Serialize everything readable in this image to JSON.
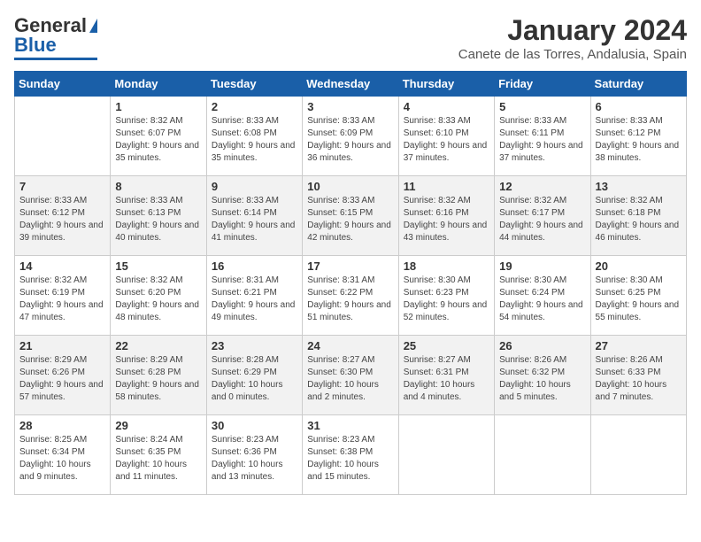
{
  "header": {
    "logo_general": "General",
    "logo_blue": "Blue",
    "title": "January 2024",
    "subtitle": "Canete de las Torres, Andalusia, Spain"
  },
  "days_of_week": [
    "Sunday",
    "Monday",
    "Tuesday",
    "Wednesday",
    "Thursday",
    "Friday",
    "Saturday"
  ],
  "weeks": [
    [
      {
        "day": "",
        "sunrise": "",
        "sunset": "",
        "daylight": ""
      },
      {
        "day": "1",
        "sunrise": "Sunrise: 8:32 AM",
        "sunset": "Sunset: 6:07 PM",
        "daylight": "Daylight: 9 hours and 35 minutes."
      },
      {
        "day": "2",
        "sunrise": "Sunrise: 8:33 AM",
        "sunset": "Sunset: 6:08 PM",
        "daylight": "Daylight: 9 hours and 35 minutes."
      },
      {
        "day": "3",
        "sunrise": "Sunrise: 8:33 AM",
        "sunset": "Sunset: 6:09 PM",
        "daylight": "Daylight: 9 hours and 36 minutes."
      },
      {
        "day": "4",
        "sunrise": "Sunrise: 8:33 AM",
        "sunset": "Sunset: 6:10 PM",
        "daylight": "Daylight: 9 hours and 37 minutes."
      },
      {
        "day": "5",
        "sunrise": "Sunrise: 8:33 AM",
        "sunset": "Sunset: 6:11 PM",
        "daylight": "Daylight: 9 hours and 37 minutes."
      },
      {
        "day": "6",
        "sunrise": "Sunrise: 8:33 AM",
        "sunset": "Sunset: 6:12 PM",
        "daylight": "Daylight: 9 hours and 38 minutes."
      }
    ],
    [
      {
        "day": "7",
        "sunrise": "Sunrise: 8:33 AM",
        "sunset": "Sunset: 6:12 PM",
        "daylight": "Daylight: 9 hours and 39 minutes."
      },
      {
        "day": "8",
        "sunrise": "Sunrise: 8:33 AM",
        "sunset": "Sunset: 6:13 PM",
        "daylight": "Daylight: 9 hours and 40 minutes."
      },
      {
        "day": "9",
        "sunrise": "Sunrise: 8:33 AM",
        "sunset": "Sunset: 6:14 PM",
        "daylight": "Daylight: 9 hours and 41 minutes."
      },
      {
        "day": "10",
        "sunrise": "Sunrise: 8:33 AM",
        "sunset": "Sunset: 6:15 PM",
        "daylight": "Daylight: 9 hours and 42 minutes."
      },
      {
        "day": "11",
        "sunrise": "Sunrise: 8:32 AM",
        "sunset": "Sunset: 6:16 PM",
        "daylight": "Daylight: 9 hours and 43 minutes."
      },
      {
        "day": "12",
        "sunrise": "Sunrise: 8:32 AM",
        "sunset": "Sunset: 6:17 PM",
        "daylight": "Daylight: 9 hours and 44 minutes."
      },
      {
        "day": "13",
        "sunrise": "Sunrise: 8:32 AM",
        "sunset": "Sunset: 6:18 PM",
        "daylight": "Daylight: 9 hours and 46 minutes."
      }
    ],
    [
      {
        "day": "14",
        "sunrise": "Sunrise: 8:32 AM",
        "sunset": "Sunset: 6:19 PM",
        "daylight": "Daylight: 9 hours and 47 minutes."
      },
      {
        "day": "15",
        "sunrise": "Sunrise: 8:32 AM",
        "sunset": "Sunset: 6:20 PM",
        "daylight": "Daylight: 9 hours and 48 minutes."
      },
      {
        "day": "16",
        "sunrise": "Sunrise: 8:31 AM",
        "sunset": "Sunset: 6:21 PM",
        "daylight": "Daylight: 9 hours and 49 minutes."
      },
      {
        "day": "17",
        "sunrise": "Sunrise: 8:31 AM",
        "sunset": "Sunset: 6:22 PM",
        "daylight": "Daylight: 9 hours and 51 minutes."
      },
      {
        "day": "18",
        "sunrise": "Sunrise: 8:30 AM",
        "sunset": "Sunset: 6:23 PM",
        "daylight": "Daylight: 9 hours and 52 minutes."
      },
      {
        "day": "19",
        "sunrise": "Sunrise: 8:30 AM",
        "sunset": "Sunset: 6:24 PM",
        "daylight": "Daylight: 9 hours and 54 minutes."
      },
      {
        "day": "20",
        "sunrise": "Sunrise: 8:30 AM",
        "sunset": "Sunset: 6:25 PM",
        "daylight": "Daylight: 9 hours and 55 minutes."
      }
    ],
    [
      {
        "day": "21",
        "sunrise": "Sunrise: 8:29 AM",
        "sunset": "Sunset: 6:26 PM",
        "daylight": "Daylight: 9 hours and 57 minutes."
      },
      {
        "day": "22",
        "sunrise": "Sunrise: 8:29 AM",
        "sunset": "Sunset: 6:28 PM",
        "daylight": "Daylight: 9 hours and 58 minutes."
      },
      {
        "day": "23",
        "sunrise": "Sunrise: 8:28 AM",
        "sunset": "Sunset: 6:29 PM",
        "daylight": "Daylight: 10 hours and 0 minutes."
      },
      {
        "day": "24",
        "sunrise": "Sunrise: 8:27 AM",
        "sunset": "Sunset: 6:30 PM",
        "daylight": "Daylight: 10 hours and 2 minutes."
      },
      {
        "day": "25",
        "sunrise": "Sunrise: 8:27 AM",
        "sunset": "Sunset: 6:31 PM",
        "daylight": "Daylight: 10 hours and 4 minutes."
      },
      {
        "day": "26",
        "sunrise": "Sunrise: 8:26 AM",
        "sunset": "Sunset: 6:32 PM",
        "daylight": "Daylight: 10 hours and 5 minutes."
      },
      {
        "day": "27",
        "sunrise": "Sunrise: 8:26 AM",
        "sunset": "Sunset: 6:33 PM",
        "daylight": "Daylight: 10 hours and 7 minutes."
      }
    ],
    [
      {
        "day": "28",
        "sunrise": "Sunrise: 8:25 AM",
        "sunset": "Sunset: 6:34 PM",
        "daylight": "Daylight: 10 hours and 9 minutes."
      },
      {
        "day": "29",
        "sunrise": "Sunrise: 8:24 AM",
        "sunset": "Sunset: 6:35 PM",
        "daylight": "Daylight: 10 hours and 11 minutes."
      },
      {
        "day": "30",
        "sunrise": "Sunrise: 8:23 AM",
        "sunset": "Sunset: 6:36 PM",
        "daylight": "Daylight: 10 hours and 13 minutes."
      },
      {
        "day": "31",
        "sunrise": "Sunrise: 8:23 AM",
        "sunset": "Sunset: 6:38 PM",
        "daylight": "Daylight: 10 hours and 15 minutes."
      },
      {
        "day": "",
        "sunrise": "",
        "sunset": "",
        "daylight": ""
      },
      {
        "day": "",
        "sunrise": "",
        "sunset": "",
        "daylight": ""
      },
      {
        "day": "",
        "sunrise": "",
        "sunset": "",
        "daylight": ""
      }
    ]
  ]
}
